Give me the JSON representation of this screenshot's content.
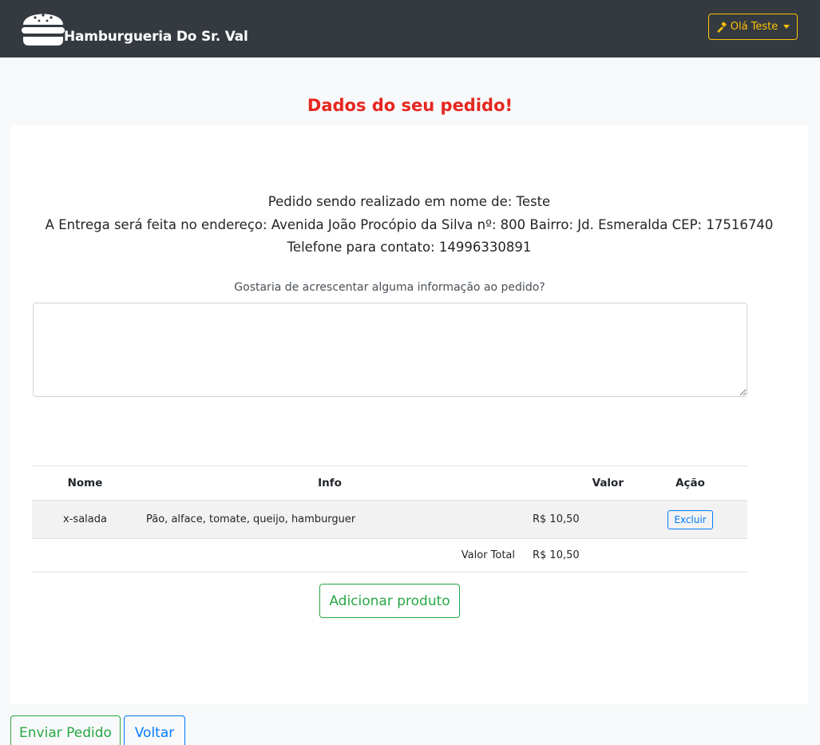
{
  "navbar": {
    "brand": "Hamburgueria Do Sr. Val",
    "brand_icon": "hamburger-icon",
    "user_button_label": "Olá Teste",
    "user_button_icon": "hammer-icon"
  },
  "page": {
    "title": "Dados do seu pedido!"
  },
  "order_info": {
    "customer_line": "Pedido sendo realizado em nome de: Teste",
    "address_line": "A Entrega será feita no endereço: Avenida João Procópio da Silva nº: 800 Bairro: Jd. Esmeralda CEP: 17516740",
    "phone_line": "Telefone para contato: 14996330891"
  },
  "extra_info": {
    "label": "Gostaria de acrescentar alguma informação ao pedido?",
    "value": ""
  },
  "table": {
    "headers": {
      "nome": "Nome",
      "info": "Info",
      "valor": "Valor",
      "acao": "Ação"
    },
    "rows": [
      {
        "nome": "x-salada",
        "info": "Pão, alface, tomate, queijo, hamburguer",
        "valor": "R$ 10,50",
        "action_label": "Excluir"
      }
    ],
    "total_label": "Valor Total",
    "total_value": "R$ 10,50"
  },
  "buttons": {
    "add_product": "Adicionar produto",
    "send_order": "Enviar Pedido",
    "back": "Voltar"
  },
  "colors": {
    "navbar_bg": "#343a40",
    "title_red": "#e5261f",
    "warning": "#ffc107",
    "success": "#28a745",
    "primary": "#007bff"
  }
}
